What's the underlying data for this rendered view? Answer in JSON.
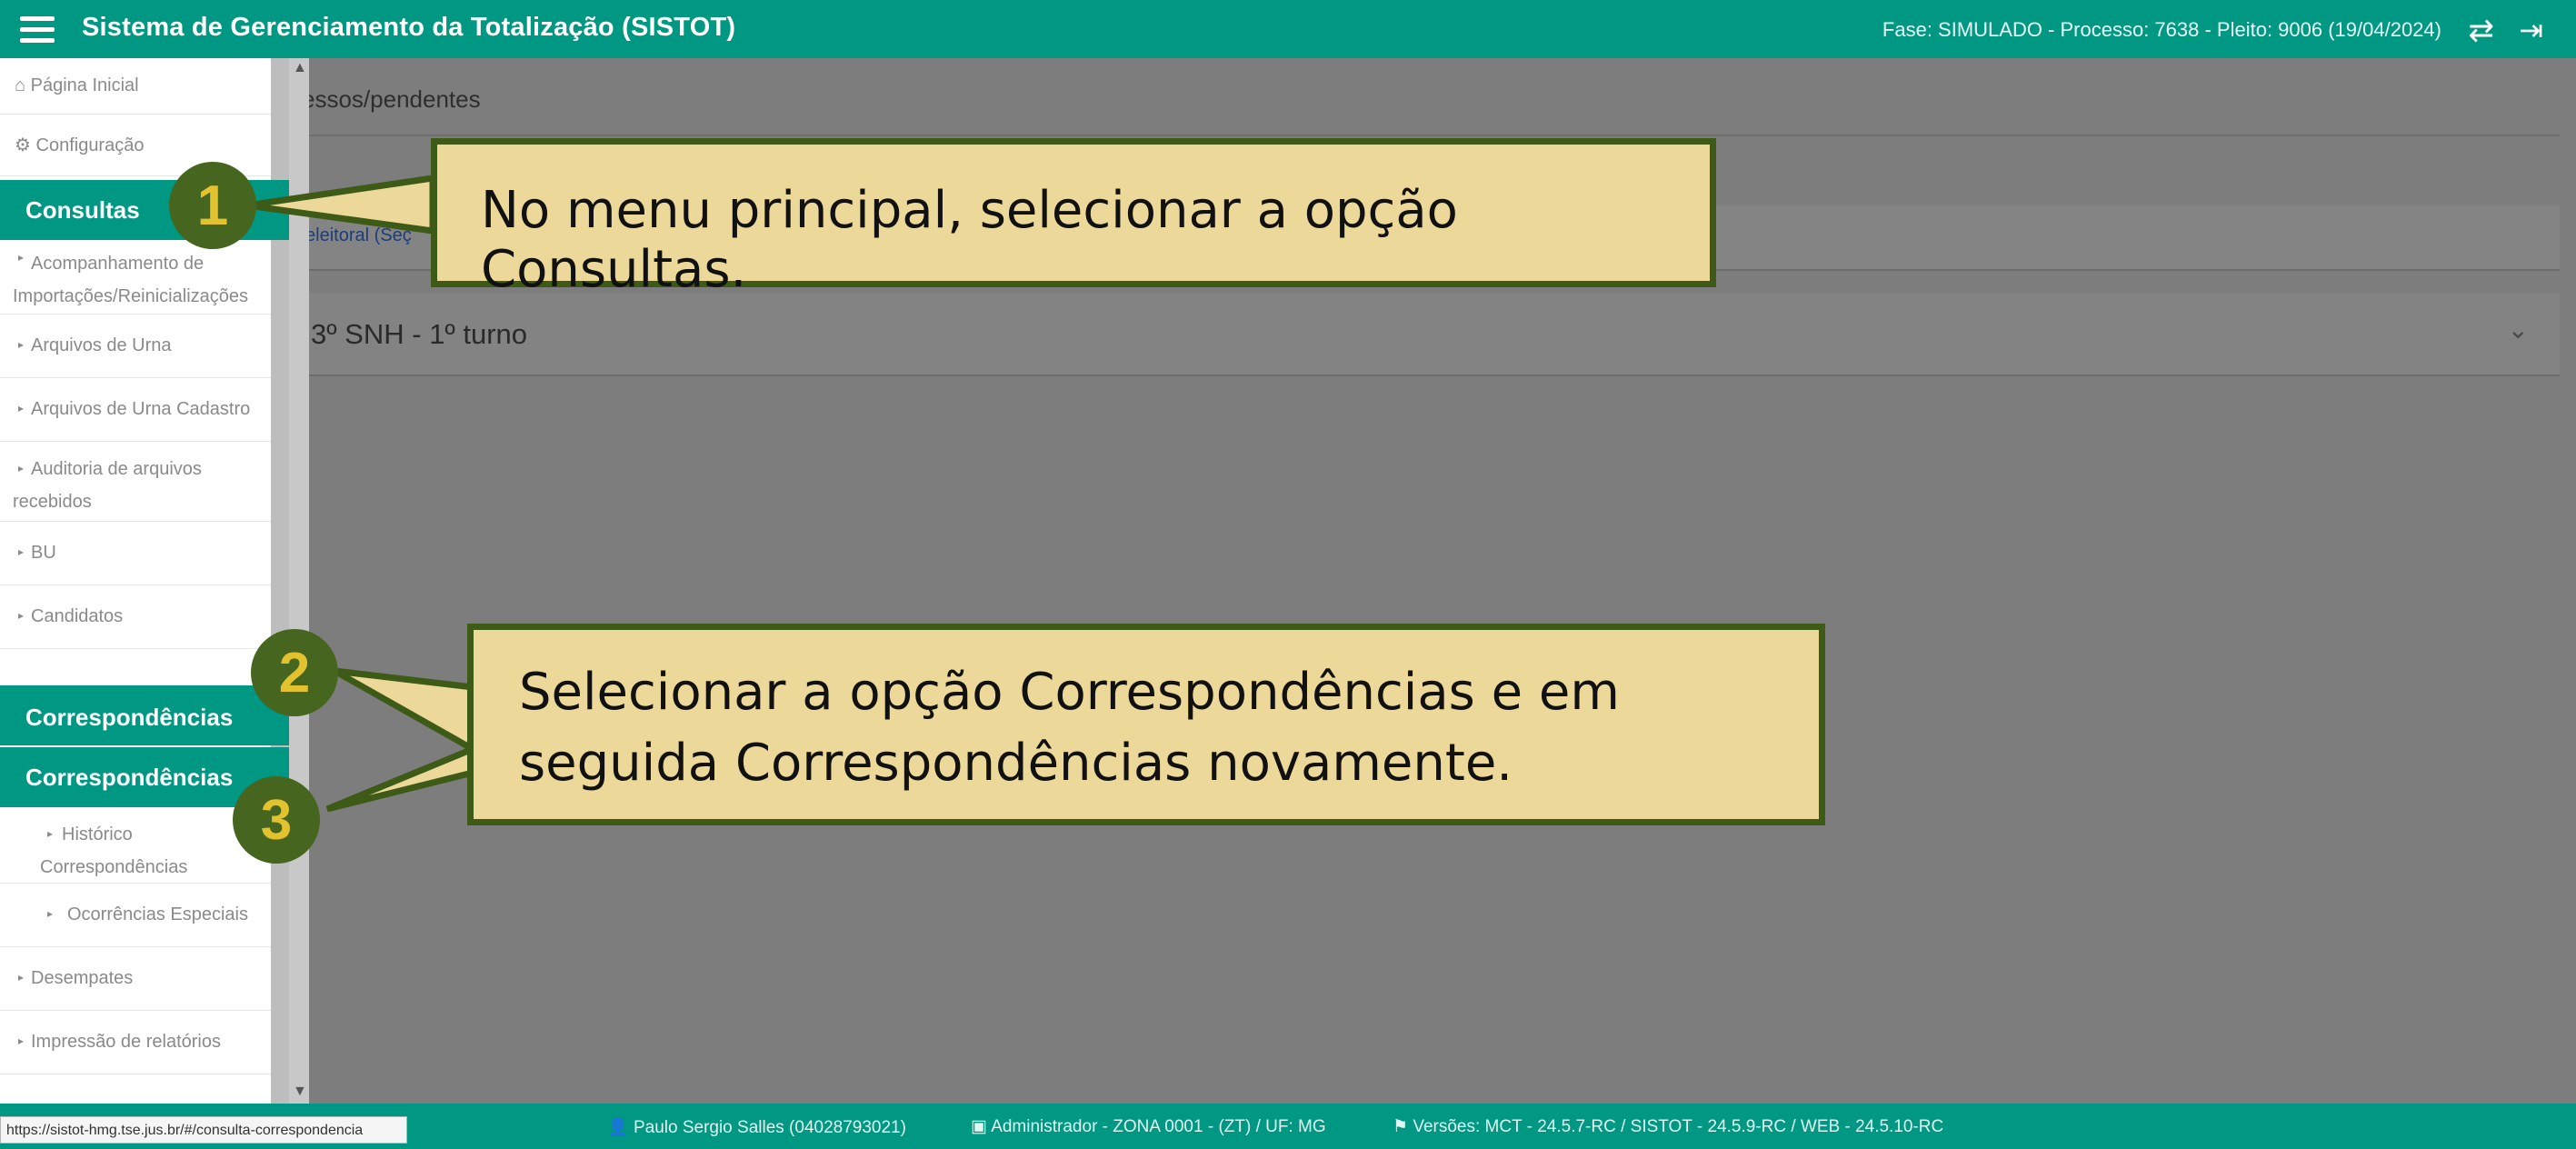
{
  "header": {
    "title": "Sistema de Gerenciamento da Totalização (SISTOT)",
    "status": "Fase: SIMULADO - Processo: 7638 - Pleito: 9006 (19/04/2024)"
  },
  "main": {
    "breadcrumb": "essos/pendentes",
    "panel1_link": "eleitoral (Seç",
    "panel2_title": "3º SNH - 1º turno"
  },
  "sidebar": {
    "home": "Página Inicial",
    "config": "Configuração",
    "consultas": "Consultas",
    "items": [
      "Acompanhamento de Importações/Reinicializações",
      "Arquivos de Urna",
      "Arquivos de Urna Cadastro",
      "Auditoria de arquivos recebidos",
      "BU",
      "Candidatos"
    ],
    "correspondencias_1": "Correspondências",
    "correspondencias_2": "Correspondências",
    "sub_items": [
      "Histórico Correspondências",
      "Ocorrências Especiais"
    ],
    "items_after": [
      "Desempates",
      "Impressão de relatórios"
    ]
  },
  "footer": {
    "user": "Paulo Sergio Salles (04028793021)",
    "role": "Administrador - ZONA 0001 - (ZT) / UF: MG",
    "versions": "Versões: MCT - 24.5.7-RC / SISTOT - 24.5.9-RC / WEB - 24.5.10-RC",
    "url": "https://sistot-hmg.tse.jus.br/#/consulta-correspondencia"
  },
  "callouts": {
    "step1_text": "No menu principal, selecionar a opção Consultas.",
    "step2_text": "Selecionar a opção Correspondências e em seguida Correspondências novamente.",
    "markers": [
      "1",
      "2",
      "3"
    ]
  },
  "colors": {
    "teal": "#009882",
    "callout_bg": "#ecd99a",
    "callout_border": "#3d5a16",
    "marker_bg": "#46651e",
    "marker_text": "#e3c230"
  }
}
